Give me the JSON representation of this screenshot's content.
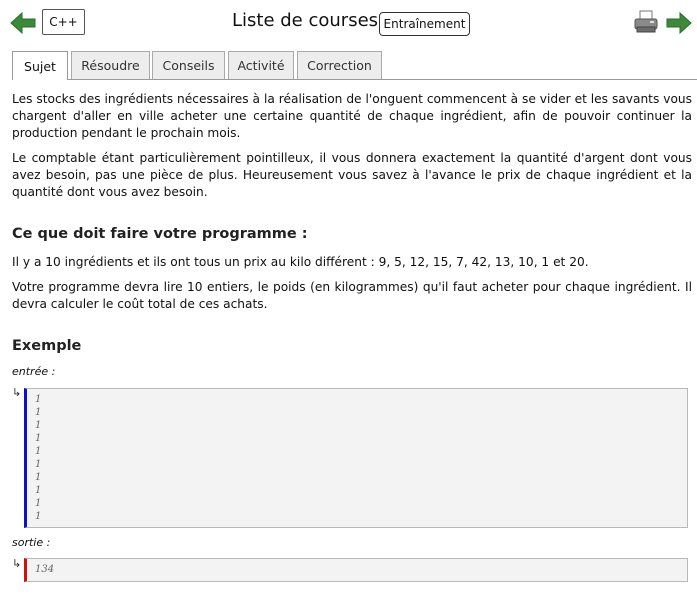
{
  "header": {
    "language_label": "C++",
    "title": "Liste de courses",
    "mode_label": "Entraînement",
    "icons": {
      "back": "arrow-left-icon",
      "forward": "arrow-right-icon",
      "print": "printer-icon"
    }
  },
  "tabs": [
    {
      "label": "Sujet",
      "active": true
    },
    {
      "label": "Résoudre"
    },
    {
      "label": "Conseils"
    },
    {
      "label": "Activité"
    },
    {
      "label": "Correction"
    }
  ],
  "statement": {
    "p1": "Les stocks des ingrédients nécessaires à la réalisation de l'onguent commencent à se vider et les savants vous chargent d'aller en ville acheter une certaine quantité de chaque ingrédient, afin de pouvoir continuer la production pendant le prochain mois.",
    "p2": "Le comptable étant particulièrement pointilleux, il vous donnera exactement la quantité d'argent dont vous avez besoin, pas une pièce de plus. Heureusement vous savez à l'avance le prix de chaque ingrédient et la quantité dont vous avez besoin.",
    "section_title": "Ce que doit faire votre programme :",
    "p3": "Il y a 10 ingrédients et ils ont tous un prix au kilo différent : 9, 5, 12, 15, 7, 42, 13, 10, 1 et 20.",
    "p4": "Votre programme devra lire 10 entiers, le poids (en kilogrammes) qu'il faut acheter pour chaque ingrédient. Il devra calculer le coût total de ces achats."
  },
  "example": {
    "title": "Exemple",
    "input_label": "entrée :",
    "input_lines": "1\n1\n1\n1\n1\n1\n1\n1\n1\n1",
    "output_label": "sortie :",
    "output_lines": "134",
    "return_glyph": "↳"
  },
  "colors": {
    "arrow_green": "#3a8a3a",
    "input_bar": "#1010c8",
    "output_bar": "#d01010"
  }
}
